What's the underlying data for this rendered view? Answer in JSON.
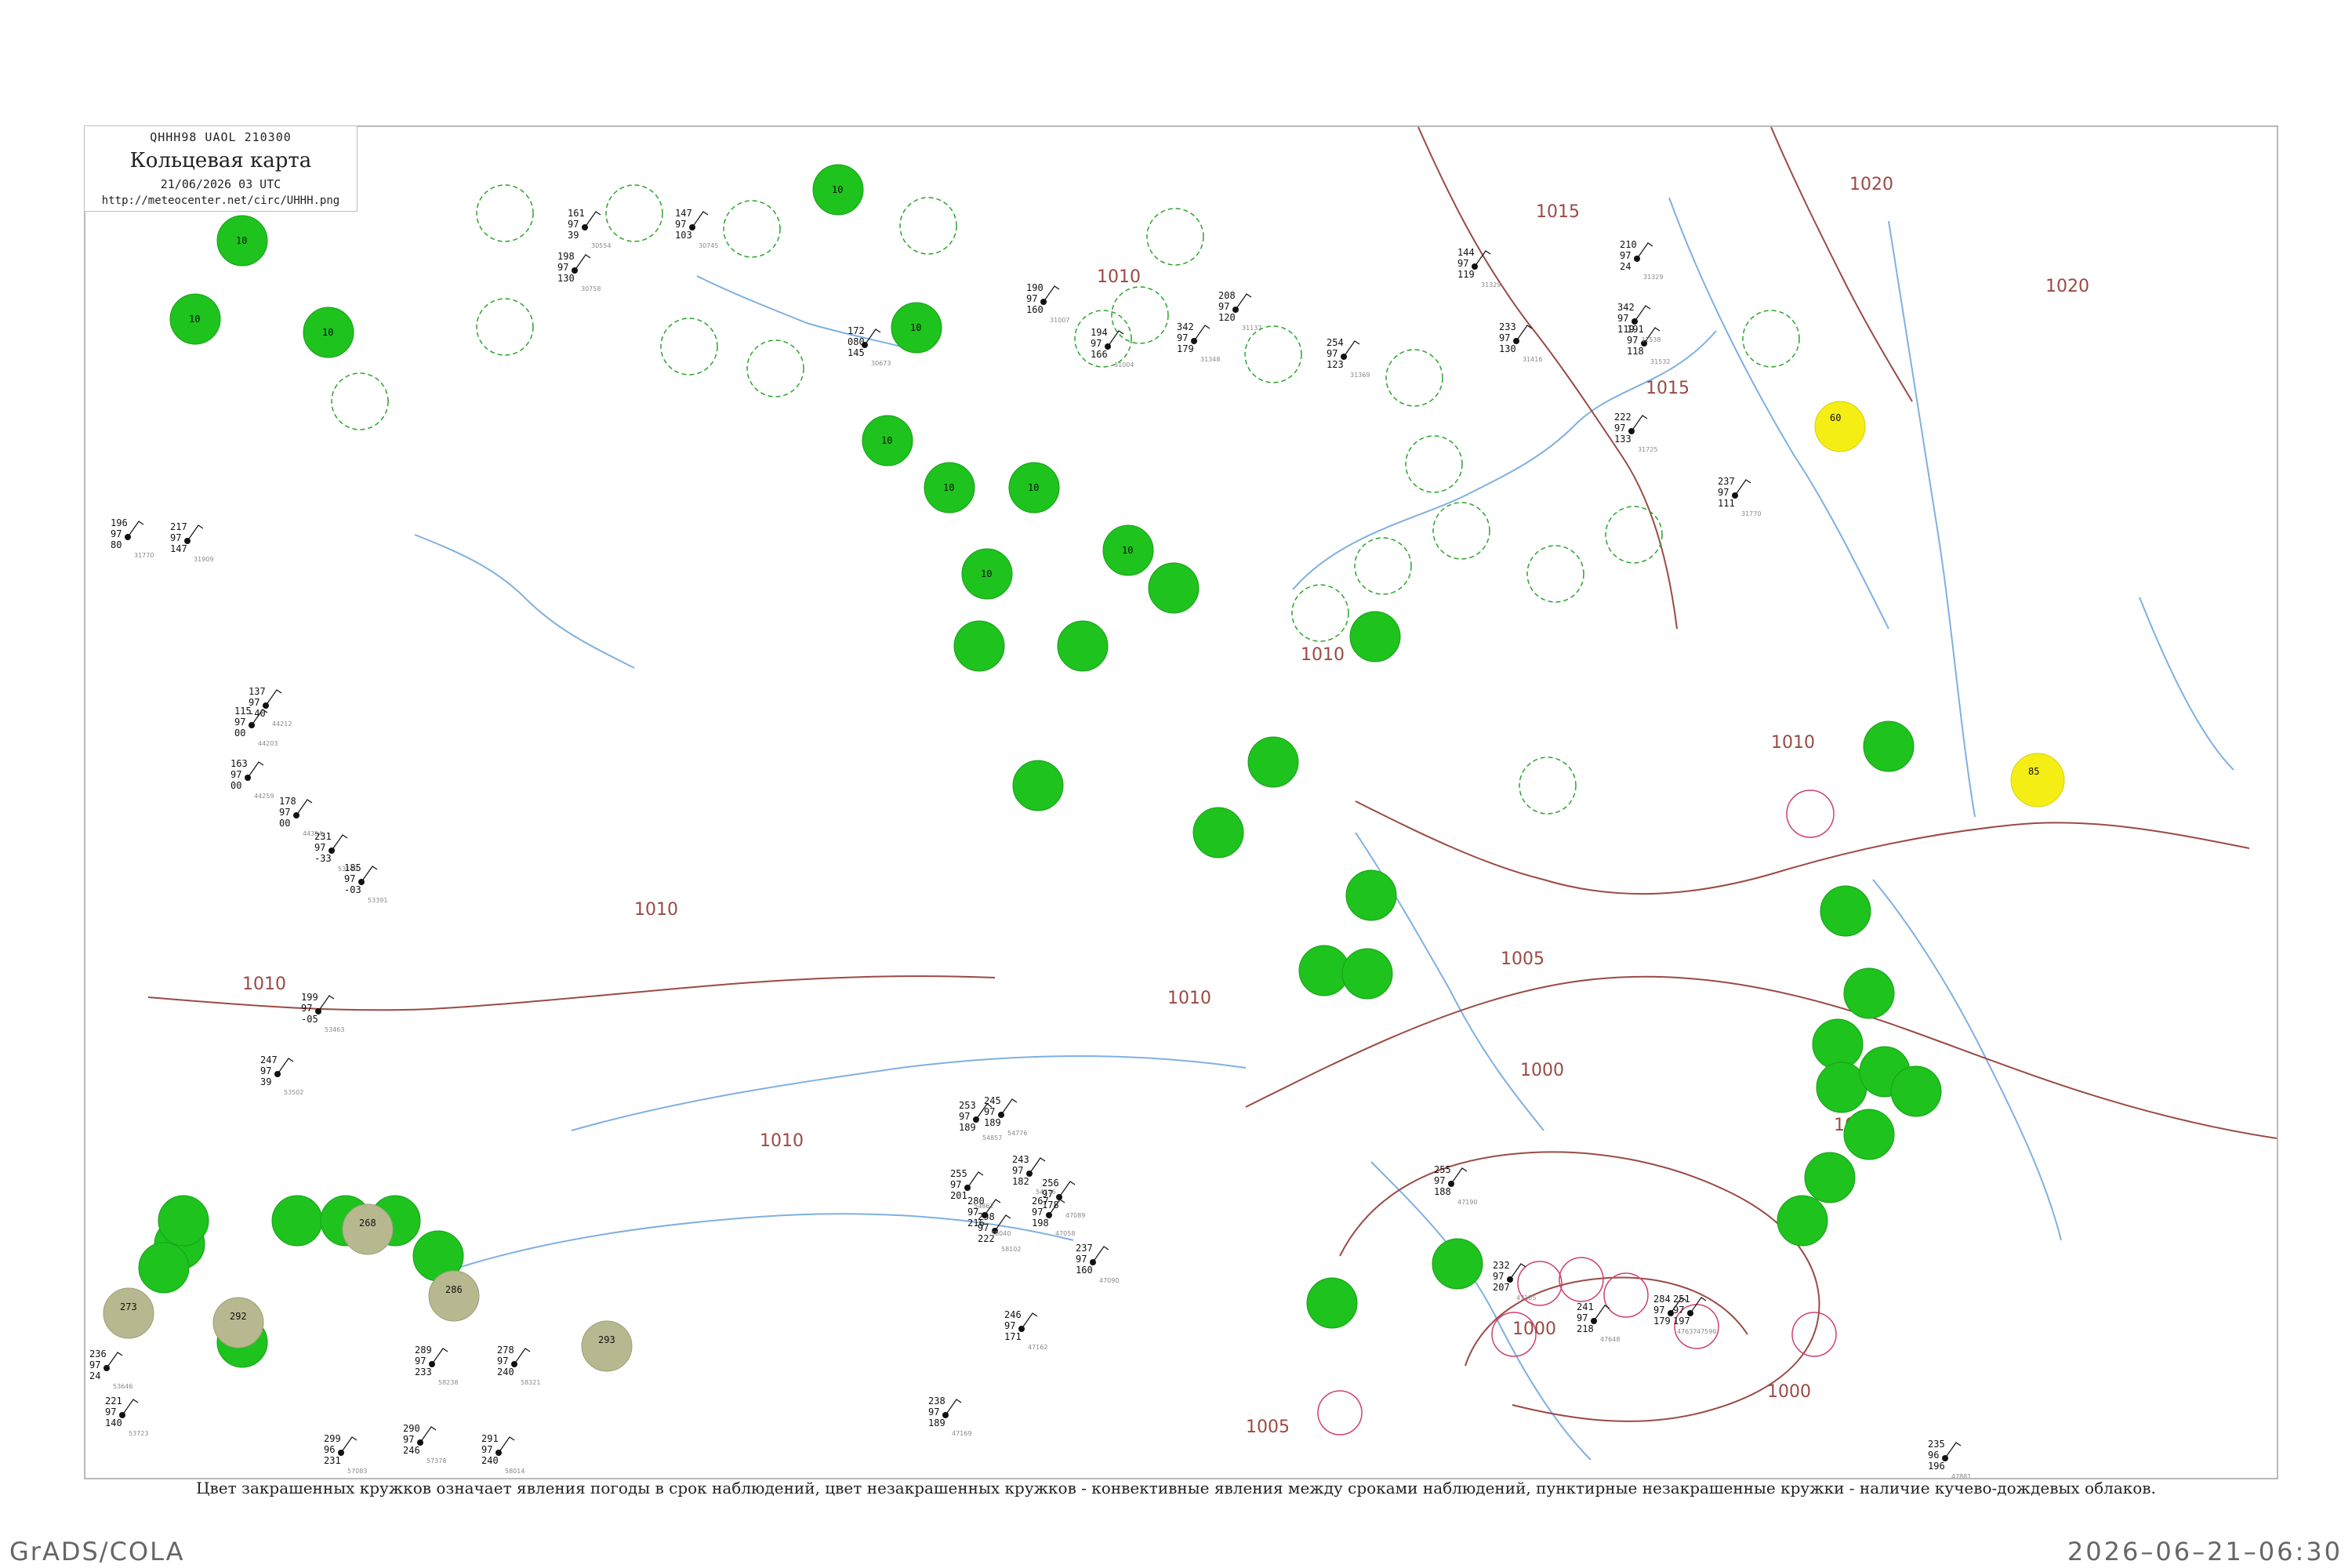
{
  "header": {
    "code_line": "QHHH98  UAOL  210300",
    "title": "Кольцевая карта",
    "date_line": "21/06/2026 03 UTC",
    "url": "http://meteocenter.net/circ/UHHH.png"
  },
  "caption": "Цвет закрашенных кружков означает явления погоды в срок наблюдений, цвет незакрашенных кружков - конвективные явления между сроками наблюдений, пунктирные незакрашенные кружки - наличие кучево-дождевых облаков.",
  "footer": {
    "left": "GrADS/COLA",
    "right": "2026–06–21–06:30"
  },
  "colors": {
    "contour": "#9a4a44",
    "water": "#7fb0e0",
    "rain": "#1ec31e",
    "fog": "#f5ee14",
    "haze": "#b8b890",
    "cb_dashed": "#2aa52a",
    "thunder": "#d04070",
    "station": "#111111"
  },
  "isobar_labels": [
    "1020",
    "1020",
    "1015",
    "1015",
    "1010",
    "1010",
    "1010",
    "1010",
    "1010",
    "1010",
    "1005",
    "1005",
    "1000",
    "1000",
    "1000",
    "1005",
    "1010"
  ],
  "map": {
    "filled_rain_circles": [
      {
        "label": "10"
      },
      {
        "label": "10"
      },
      {
        "label": "10"
      },
      {
        "label": "10"
      },
      {
        "label": "10"
      },
      {
        "label": "10"
      },
      {
        "label": "10"
      },
      {
        "label": "10"
      },
      {
        "label": "10"
      },
      {
        "label": "10"
      }
    ],
    "filled_fog_circles": [
      {
        "label": "60"
      },
      {
        "label": "85"
      }
    ],
    "filled_haze_circles": [
      {
        "label": "268"
      },
      {
        "label": "286"
      },
      {
        "label": "293"
      },
      {
        "label": "273"
      },
      {
        "label": "292"
      }
    ],
    "stations": [
      {
        "p": "161",
        "t": "97",
        "d": "39",
        "name": "30554"
      },
      {
        "p": "147",
        "t": "97",
        "d": "103",
        "name": "30745"
      },
      {
        "p": "198",
        "t": "97",
        "d": "130",
        "name": "30758"
      },
      {
        "p": "172",
        "t": "080",
        "d": "145",
        "name": "30673"
      },
      {
        "p": "190",
        "t": "97",
        "d": "160",
        "name": "31007"
      },
      {
        "p": "194",
        "t": "97",
        "d": "166",
        "name": "31004"
      },
      {
        "p": "208",
        "t": "97",
        "d": "120",
        "name": "31137"
      },
      {
        "p": "144",
        "t": "97",
        "d": "119",
        "name": "31329"
      },
      {
        "p": "342",
        "t": "97",
        "d": "179",
        "name": "31348"
      },
      {
        "p": "254",
        "t": "97",
        "d": "123",
        "name": "31369"
      },
      {
        "p": "233",
        "t": "97",
        "d": "130",
        "name": "31416"
      },
      {
        "p": "191",
        "t": "97",
        "d": "118",
        "name": "31532"
      },
      {
        "p": "342",
        "t": "97",
        "d": "119",
        "name": "31538"
      },
      {
        "p": "210",
        "t": "97",
        "d": "24",
        "name": "31329"
      },
      {
        "p": "222",
        "t": "97",
        "d": "133",
        "name": "31725"
      },
      {
        "p": "237",
        "t": "97",
        "d": "111",
        "name": "31770"
      },
      {
        "p": "196",
        "t": "97",
        "d": "80",
        "name": "31770"
      },
      {
        "p": "217",
        "t": "97",
        "d": "147",
        "name": "31909"
      },
      {
        "p": "137",
        "t": "97",
        "d": "-40",
        "name": "44212"
      },
      {
        "p": "115",
        "t": "97",
        "d": "00",
        "name": "44203"
      },
      {
        "p": "163",
        "t": "97",
        "d": "00",
        "name": "44259"
      },
      {
        "p": "178",
        "t": "97",
        "d": "00",
        "name": "44354"
      },
      {
        "p": "231",
        "t": "97",
        "d": "-33",
        "name": "53149"
      },
      {
        "p": "185",
        "t": "97",
        "d": "-03",
        "name": "53391"
      },
      {
        "p": "199",
        "t": "97",
        "d": "-05",
        "name": "53463"
      },
      {
        "p": "247",
        "t": "97",
        "d": "39",
        "name": "53502"
      },
      {
        "p": "236",
        "t": "97",
        "d": "24",
        "name": "53646"
      },
      {
        "p": "221",
        "t": "97",
        "d": "140",
        "name": "53723"
      },
      {
        "p": "299",
        "t": "96",
        "d": "231",
        "name": "57083"
      },
      {
        "p": "290",
        "t": "97",
        "d": "246",
        "name": "57378"
      },
      {
        "p": "291",
        "t": "97",
        "d": "240",
        "name": "58014"
      },
      {
        "p": "278",
        "t": "97",
        "d": "240",
        "name": "58321"
      },
      {
        "p": "289",
        "t": "97",
        "d": "233",
        "name": "58238"
      },
      {
        "p": "298",
        "t": "97",
        "d": "222",
        "name": "58102"
      },
      {
        "p": "280",
        "t": "97",
        "d": "216",
        "name": "58040"
      },
      {
        "p": "255",
        "t": "97",
        "d": "201",
        "name": "54862"
      },
      {
        "p": "253",
        "t": "97",
        "d": "189",
        "name": "54857"
      },
      {
        "p": "245",
        "t": "97",
        "d": "189",
        "name": "54776"
      },
      {
        "p": "243",
        "t": "97",
        "d": "182",
        "name": "54776"
      },
      {
        "p": "267",
        "t": "97",
        "d": "198",
        "name": "47058"
      },
      {
        "p": "256",
        "t": "97",
        "d": "178",
        "name": "47089"
      },
      {
        "p": "237",
        "t": "97",
        "d": "160",
        "name": "47090"
      },
      {
        "p": "246",
        "t": "97",
        "d": "171",
        "name": "47162"
      },
      {
        "p": "238",
        "t": "97",
        "d": "189",
        "name": "47169"
      },
      {
        "p": "255",
        "t": "97",
        "d": "188",
        "name": "47190"
      },
      {
        "p": "232",
        "t": "97",
        "d": "207",
        "name": "47185"
      },
      {
        "p": "241",
        "t": "97",
        "d": "218",
        "name": "47648"
      },
      {
        "p": "251",
        "t": "97",
        "d": "197",
        "name": "47590"
      },
      {
        "p": "284",
        "t": "97",
        "d": "179",
        "name": "47637"
      },
      {
        "p": "235",
        "t": "96",
        "d": "196",
        "name": "47881"
      }
    ]
  }
}
